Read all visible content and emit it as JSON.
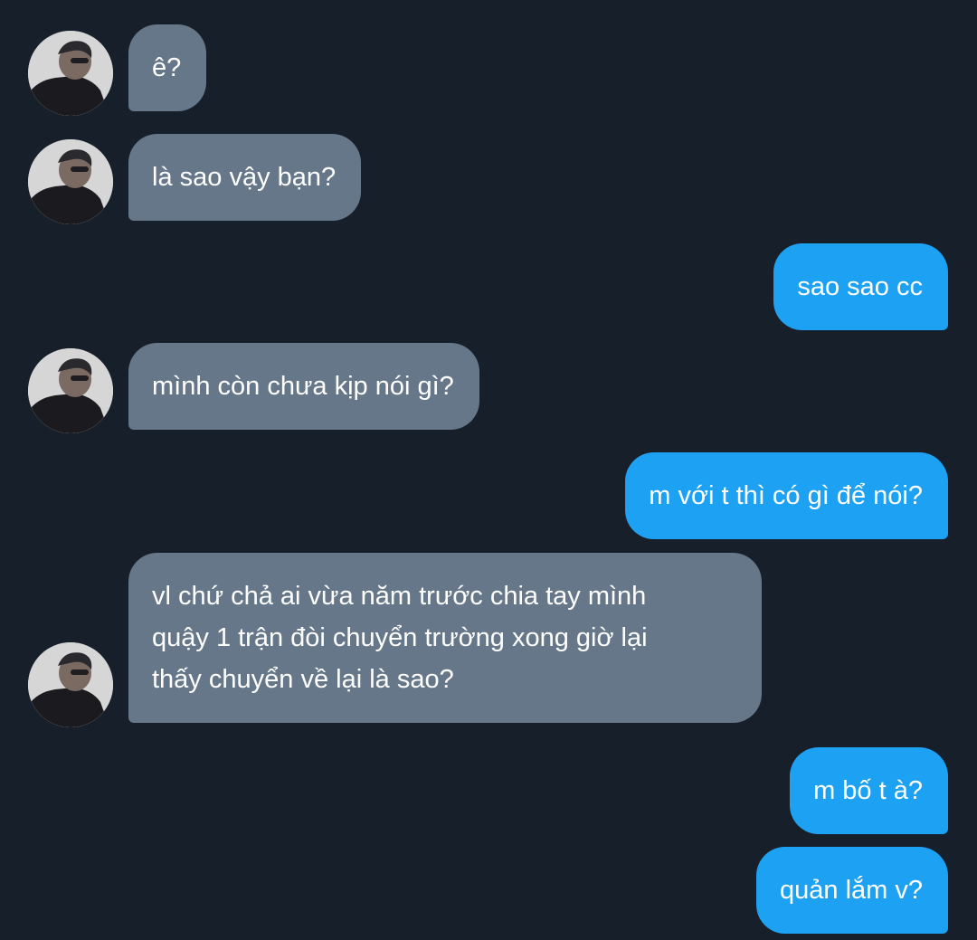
{
  "conversation": {
    "messages": [
      {
        "direction": "received",
        "text": "ê?"
      },
      {
        "direction": "received",
        "text": "là sao vậy bạn?"
      },
      {
        "direction": "sent",
        "text": "sao sao cc"
      },
      {
        "direction": "received",
        "text": "mình còn chưa kịp nói gì?"
      },
      {
        "direction": "sent",
        "text": "m với t thì có gì để nói?"
      },
      {
        "direction": "received",
        "lines": [
          "vl chứ chả ai vừa năm trước chia tay mình",
          "quậy 1 trận đòi chuyển trường xong giờ lại",
          "thấy chuyển về lại là sao?"
        ]
      },
      {
        "direction": "sent",
        "text": "m bố t à?"
      },
      {
        "direction": "sent",
        "text": "quản lắm v?"
      }
    ]
  },
  "colors": {
    "background": "#17202a",
    "received_bubble": "#66778a",
    "sent_bubble": "#1da1f2",
    "text": "#ffffff"
  },
  "icons": {
    "avatar": "contact-avatar-photo"
  }
}
